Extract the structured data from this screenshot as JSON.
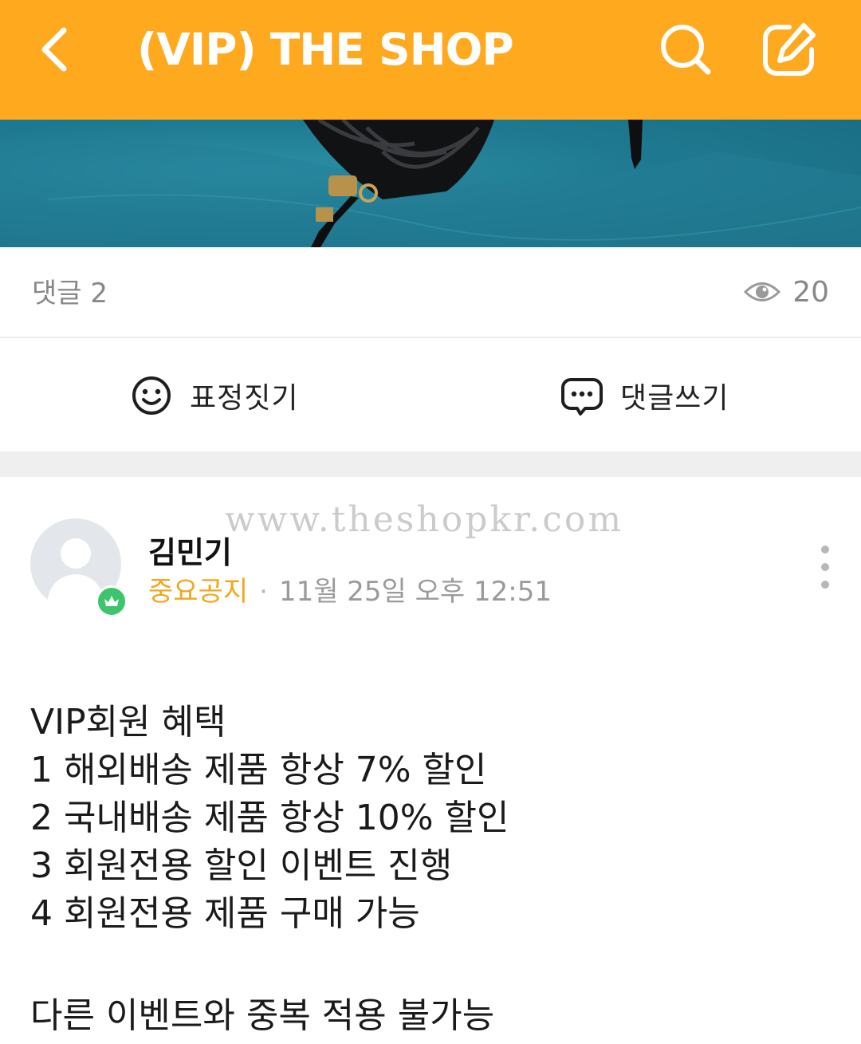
{
  "header": {
    "title": "(VIP) THE SHOP",
    "back_icon": "chevron-left-icon",
    "search_icon": "search-icon",
    "write_icon": "edit-icon",
    "background_color": "#FFA91F"
  },
  "stats": {
    "comment_count_label": "댓글 2",
    "view_icon": "eye-icon",
    "view_count": "20"
  },
  "actions": {
    "emote_label": "표정짓기",
    "comment_label": "댓글쓰기"
  },
  "post": {
    "watermark": "www.theshopkr.com",
    "author": "김민기",
    "board": "중요공지",
    "separator": "·",
    "time": "11월 25일 오후 12:51",
    "body_lines": [
      "VIP회원 혜택",
      "1 해외배송 제품 항상 7% 할인",
      "2 국내배송 제품 항상 10% 할인",
      "3 회원전용 할인 이벤트 진행",
      "4 회원전용 제품 구매 가능"
    ],
    "footer_line": "다른 이벤트와 중복 적용 불가능"
  },
  "colors": {
    "accent": "#FFA91F",
    "board_name": "#F2A61C",
    "badge": "#3cc56c"
  }
}
